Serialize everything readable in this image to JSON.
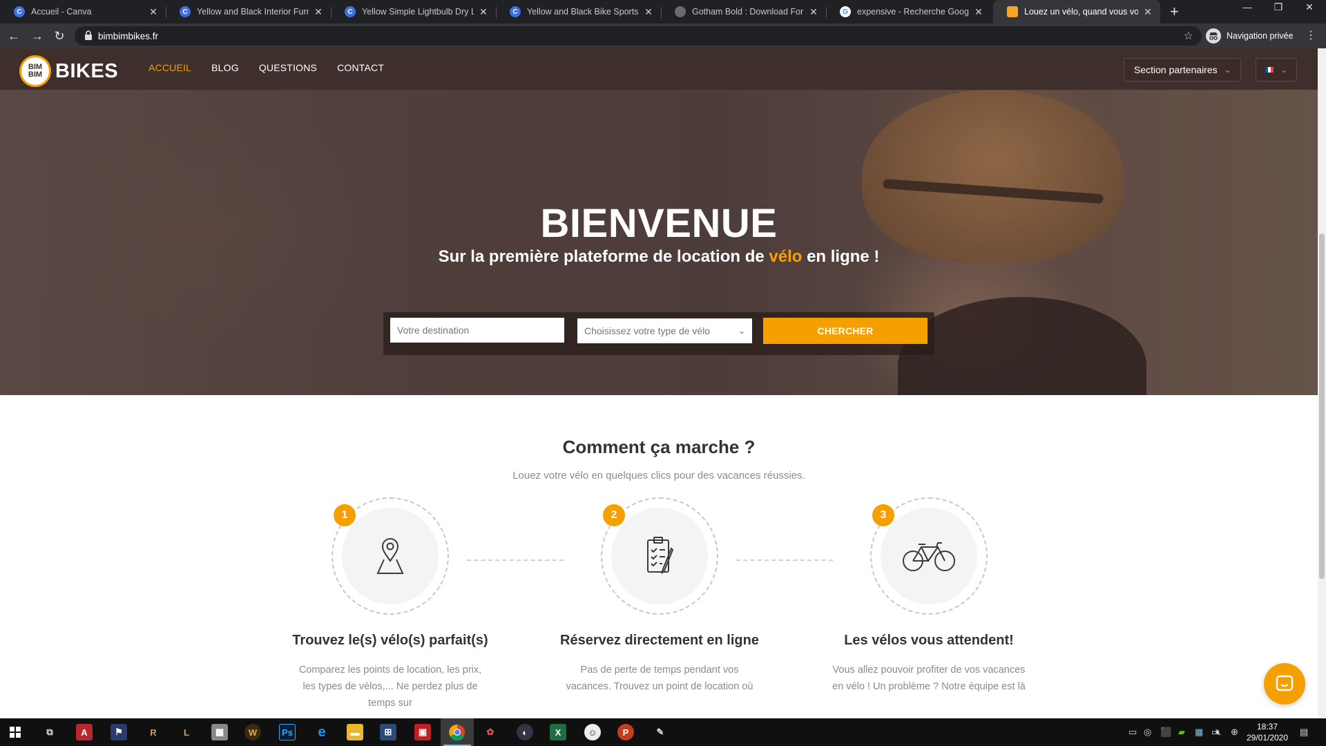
{
  "browser": {
    "tabs": [
      {
        "title": "Accueil - Canva",
        "favicon": "C"
      },
      {
        "title": "Yellow and Black Interior Furnitur",
        "favicon": "C"
      },
      {
        "title": "Yellow Simple Lightbulb Dry Lanc",
        "favicon": "C"
      },
      {
        "title": "Yellow and Black Bike Sports Flye",
        "favicon": "C"
      },
      {
        "title": "Gotham Bold : Download For Fre",
        "favicon": ""
      },
      {
        "title": "expensive - Recherche Google",
        "favicon": "G"
      },
      {
        "title": "Louez un vélo, quand vous voule",
        "favicon": ""
      }
    ],
    "new_tab": "+",
    "url": "bimbimbikes.fr",
    "profile_label": "Navigation privée",
    "window_controls": {
      "minimize": "—",
      "restore": "❐",
      "close": "✕"
    }
  },
  "site": {
    "logo": {
      "badge_line1": "BIM",
      "badge_line2": "BIM",
      "word": "BIKES"
    },
    "nav": [
      {
        "label": "ACCUEIL",
        "active": true
      },
      {
        "label": "BLOG",
        "active": false
      },
      {
        "label": "QUESTIONS",
        "active": false
      },
      {
        "label": "CONTACT",
        "active": false
      }
    ],
    "partners_label": "Section partenaires",
    "language_flag": [
      "#0055a4",
      "#ffffff",
      "#ef4135"
    ]
  },
  "hero": {
    "title": "BIENVENUE",
    "subtitle_before": "Sur la première plateforme de location de ",
    "subtitle_highlight": "vélo",
    "subtitle_after": " en ligne !",
    "destination_placeholder": "Votre destination",
    "bike_type_placeholder": "Choisissez votre type de vélo",
    "search_button": "CHERCHER"
  },
  "how_it_works": {
    "title": "Comment ça marche ?",
    "lead": "Louez votre vélo en quelques clics pour des vacances réussies.",
    "steps": [
      {
        "number": "1",
        "icon": "map-pin-icon",
        "title": "Trouvez le(s) vélo(s) parfait(s)",
        "description": "Comparez les points de location, les prix, les types de vélos,... Ne perdez plus de temps sur"
      },
      {
        "number": "2",
        "icon": "clipboard-checklist-icon",
        "title": "Réservez directement en ligne",
        "description": "Pas de perte de temps pendant vos vacances. Trouvez un point de location où"
      },
      {
        "number": "3",
        "icon": "bicycle-icon",
        "title": "Les vélos vous attendent!",
        "description": "Vous allez pouvoir profiter de vos vacances en vélo ! Un problème ? Notre équipe est là"
      }
    ]
  },
  "colors": {
    "accent": "#f5a000",
    "nav_bg": "#3e2e2c"
  },
  "taskbar": {
    "time": "18:37",
    "date": "29/01/2020"
  }
}
